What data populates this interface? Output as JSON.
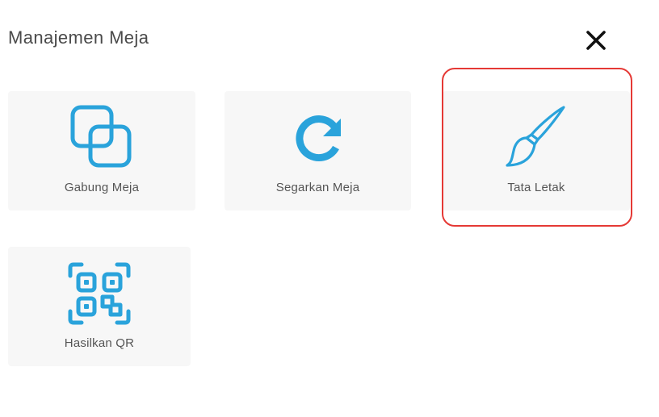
{
  "header": {
    "title": "Manajemen Meja",
    "close_icon": "close-icon"
  },
  "actions": [
    {
      "label": "Gabung Meja",
      "icon": "merge-squares-icon"
    },
    {
      "label": "Segarkan Meja",
      "icon": "refresh-icon"
    },
    {
      "label": "Tata Letak",
      "icon": "paintbrush-icon",
      "highlighted": true
    },
    {
      "label": "Hasilkan QR",
      "icon": "qr-code-icon"
    }
  ],
  "colors": {
    "icon": "#2aa3db",
    "tile_background": "#f7f7f7",
    "title_text": "#4a4a4a",
    "label_text": "#555555",
    "highlight": "#e53935"
  }
}
